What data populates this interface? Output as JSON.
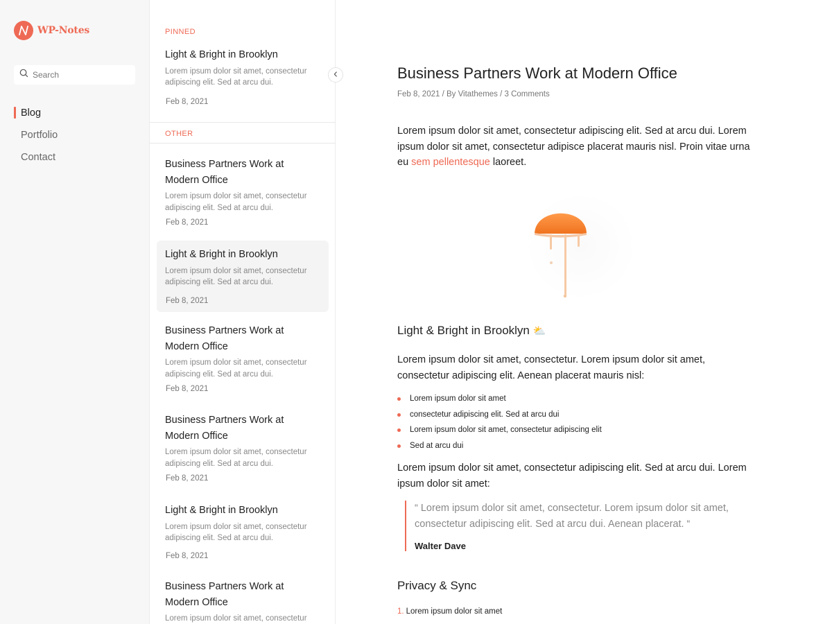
{
  "app": {
    "name": "WP-Notes",
    "brand_color": "#ee6a55"
  },
  "sidebar": {
    "search": {
      "placeholder": "Search",
      "value": ""
    },
    "nav": [
      {
        "label": "Blog",
        "active": true
      },
      {
        "label": "Portfolio",
        "active": false
      },
      {
        "label": "Contact",
        "active": false
      }
    ]
  },
  "list": {
    "pinned_label": "PINNED",
    "other_label": "OTHER",
    "pinned": [
      {
        "title": "Light & Bright in Brooklyn",
        "excerpt": "Lorem ipsum dolor sit amet, consectetur adipiscing elit. Sed at arcu dui.",
        "date": "Feb 8, 2021"
      }
    ],
    "other": [
      {
        "title": "Business Partners Work at Modern Office",
        "excerpt": "Lorem ipsum dolor sit amet, consectetur adipiscing elit. Sed at arcu dui.",
        "date": "Feb 8, 2021"
      },
      {
        "title": "Light & Bright in Brooklyn",
        "excerpt": "Lorem ipsum dolor sit amet, consectetur adipiscing elit. Sed at arcu dui.",
        "date": "Feb 8, 2021",
        "selected": true
      },
      {
        "title": "Business Partners Work at Modern Office",
        "excerpt": "Lorem ipsum dolor sit amet, consectetur adipiscing elit. Sed at arcu dui.",
        "date": "Feb 8, 2021"
      },
      {
        "title": "Business Partners Work at Modern Office",
        "excerpt": "Lorem ipsum dolor sit amet, consectetur adipiscing elit. Sed at arcu dui.",
        "date": "Feb 8, 2021"
      },
      {
        "title": "Light & Bright in Brooklyn",
        "excerpt": "Lorem ipsum dolor sit amet, consectetur adipiscing elit. Sed at arcu dui.",
        "date": "Feb 8, 2021"
      },
      {
        "title": "Business Partners Work at Modern Office",
        "excerpt": "Lorem ipsum dolor sit amet, consectetur",
        "date": ""
      }
    ]
  },
  "article": {
    "title": "Business Partners Work at Modern Office",
    "meta": {
      "date": "Feb 8, 2021",
      "sep1": " / By ",
      "author": "Vitathemes",
      "sep2": " / ",
      "comments": "3 Comments"
    },
    "intro_text": "Lorem ipsum dolor sit amet, consectetur adipiscing elit. Sed at arcu dui. Lorem ipsum dolor sit amet, consectetur adipisce placerat mauris nisl. Proin vitae urna eu ",
    "intro_link": "sem pellentesque",
    "intro_after": " laoreet.",
    "image_icon": "orange-dripping-image",
    "section1_heading": "Light & Bright in Brooklyn",
    "section1_emoji": "⛅",
    "section1_text": "Lorem ipsum dolor sit amet, consectetur. Lorem ipsum dolor sit amet, consectetur adipiscing elit. Aenean placerat mauris nisl:",
    "bullets": [
      "Lorem ipsum dolor sit amet",
      "consectetur adipiscing elit. Sed at arcu dui",
      "Lorem ipsum dolor sit amet, consectetur adipiscing elit",
      "Sed at arcu dui"
    ],
    "para3": "Lorem ipsum dolor sit amet, consectetur adipiscing elit. Sed at arcu dui. Lorem ipsum dolor sit amet:",
    "quote": {
      "text": "“ Lorem ipsum dolor sit amet, consectetur. Lorem ipsum dolor sit amet, consectetur adipiscing elit. Sed at arcu dui. Aenean placerat. “",
      "author": "Walter Dave"
    },
    "section2_heading": "Privacy & Sync",
    "ordered": [
      {
        "num": "1.",
        "text": "Lorem ipsum dolor sit amet"
      }
    ]
  }
}
